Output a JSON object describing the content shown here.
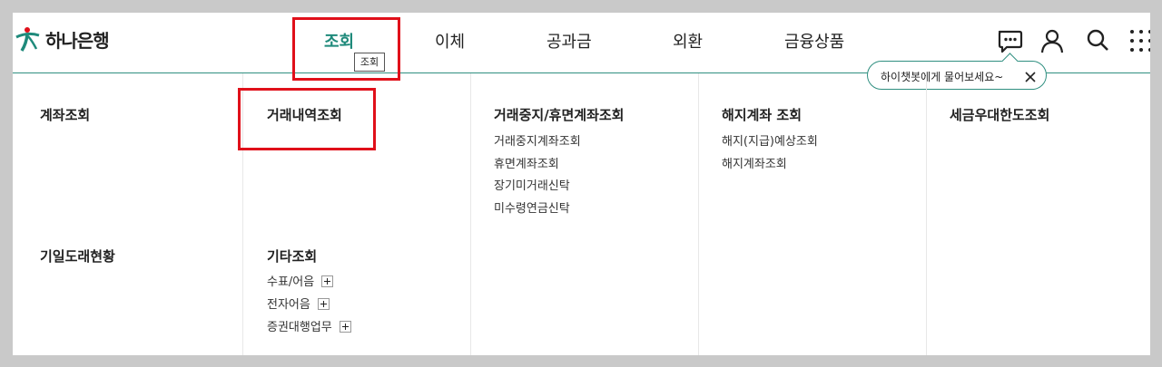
{
  "brand": {
    "name": "하나은행",
    "color": "#1f8a7b",
    "logo_icon": "hana-bank-logo-icon"
  },
  "nav": {
    "items": [
      {
        "label": "조회",
        "active": true
      },
      {
        "label": "이체"
      },
      {
        "label": "공과금"
      },
      {
        "label": "외환"
      },
      {
        "label": "금융상품"
      }
    ],
    "tooltip": "조회"
  },
  "header_icons": [
    "chatbot-icon",
    "user-icon",
    "search-icon",
    "grid-menu-icon"
  ],
  "chat_prompt": {
    "text": "하이챗봇에게 물어보세요~",
    "close_icon": "close-icon"
  },
  "menu": {
    "col1": {
      "title": "계좌조회",
      "title2": "기일도래현황"
    },
    "col2": {
      "title": "거래내역조회",
      "title2": "기타조회",
      "items": [
        "수표/어음",
        "전자어음",
        "증권대행업무"
      ]
    },
    "col3": {
      "title": "거래중지/휴면계좌조회",
      "items": [
        "거래중지계좌조회",
        "휴면계좌조회",
        "장기미거래신탁",
        "미수령연금신탁"
      ]
    },
    "col4": {
      "title": "해지계좌 조회",
      "items": [
        "해지(지급)예상조회",
        "해지계좌조회"
      ]
    },
    "col5": {
      "title": "세금우대한도조회"
    }
  },
  "highlight_color": "#e0101a"
}
